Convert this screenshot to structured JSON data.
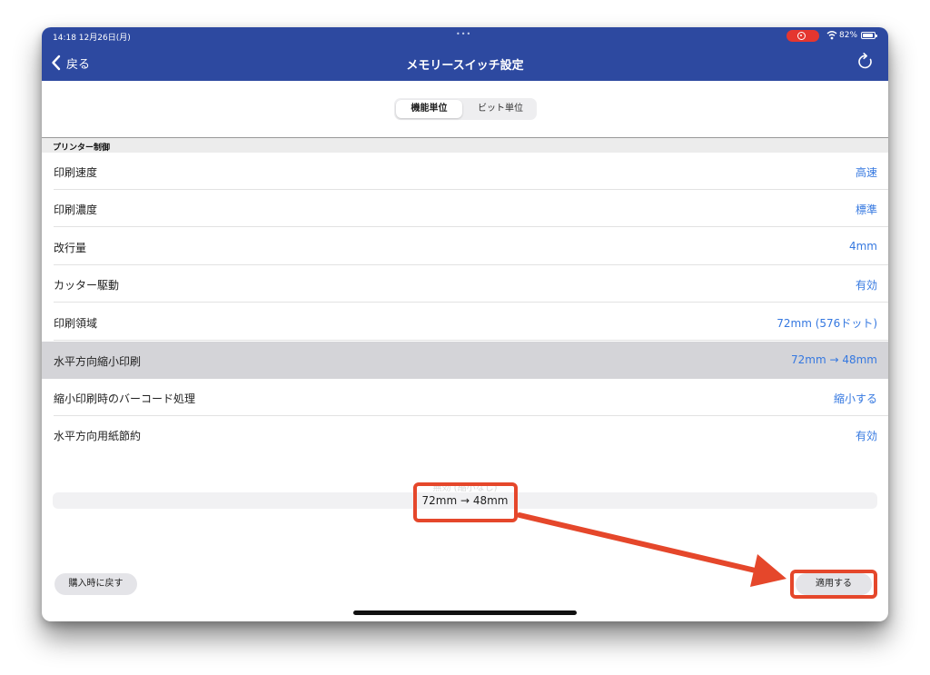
{
  "status_bar": {
    "time": "14:18  12月26日(月)",
    "dots": "•••",
    "battery": "82%"
  },
  "nav": {
    "back_label": "戻る",
    "title": "メモリースイッチ設定"
  },
  "segments": {
    "active": "機能単位",
    "inactive": "ビット単位"
  },
  "section": {
    "title": "プリンター制御",
    "rows": [
      {
        "label": "印刷速度",
        "value": "高速"
      },
      {
        "label": "印刷濃度",
        "value": "標準"
      },
      {
        "label": "改行量",
        "value": "4mm"
      },
      {
        "label": "カッター駆動",
        "value": "有効"
      },
      {
        "label": "印刷領域",
        "value": "72mm (576ドット)"
      },
      {
        "label": "水平方向縮小印刷",
        "value": "72mm → 48mm"
      },
      {
        "label": "縮小印刷時のバーコード処理",
        "value": "縮小する"
      },
      {
        "label": "水平方向用紙節約",
        "value": "有効"
      }
    ]
  },
  "picker": {
    "ghost_option": "無効 (縮小なし)",
    "selected_option": "72mm → 48mm"
  },
  "buttons": {
    "reset": "購入時に戻す",
    "apply": "適用する"
  },
  "colors": {
    "nav_bar": "#2d49a0",
    "accent_value": "#3578e0",
    "annotation": "#e5472b",
    "record_indicator": "#e5362f"
  }
}
